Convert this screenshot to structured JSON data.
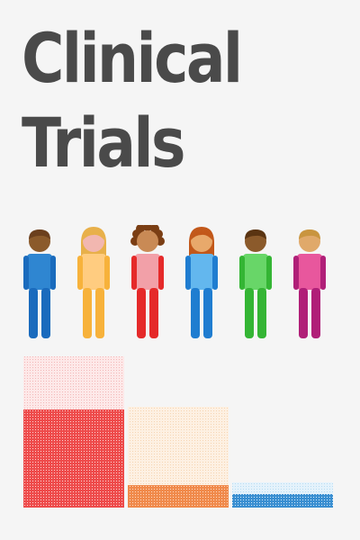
{
  "title": {
    "line1": "Clinical",
    "line2": "Trials",
    "color": "#4a4a4a"
  },
  "background": "#f5f5f5",
  "figures": [
    {
      "skin": "#8b5a2b",
      "hair": "#6b3f1d",
      "hair_style": "short",
      "shirt": "#2f86d1",
      "pants": "#1a6bbd"
    },
    {
      "skin": "#f2b7b0",
      "hair": "#e8b04a",
      "hair_style": "long",
      "shirt": "#ffcc80",
      "pants": "#f7b23b"
    },
    {
      "skin": "#c98a55",
      "hair": "#7a3e14",
      "hair_style": "curly",
      "shirt": "#f2a0a8",
      "pants": "#e52a2a"
    },
    {
      "skin": "#e8a96b",
      "hair": "#c2581a",
      "hair_style": "long",
      "shirt": "#63b7ee",
      "pants": "#1f7dd0"
    },
    {
      "skin": "#8b5a2b",
      "hair": "#5a3412",
      "hair_style": "short",
      "shirt": "#68d668",
      "pants": "#34b534"
    },
    {
      "skin": "#e0a96a",
      "hair": "#c9953f",
      "hair_style": "short",
      "shirt": "#e8579d",
      "pants": "#b01f78"
    }
  ],
  "blocks": [
    {
      "upper_fill": "#fde8e8",
      "upper_dot": "#f3b8b8",
      "upper_level": 0.35,
      "lower_fill": "#ee4b4b",
      "lower_dot": "#fbd0d0",
      "lower_level": 0.65
    },
    {
      "upper_fill": "#fdf0e2",
      "upper_dot": "#f6d5b3",
      "upper_level": 0.78,
      "lower_fill": "#f08a4b",
      "lower_dot": "#fcd7bf",
      "lower_level": 0.22
    },
    {
      "upper_fill": "#e4f2fb",
      "upper_dot": "#b9dcf2",
      "upper_level": 0.45,
      "lower_fill": "#3a8fd1",
      "lower_dot": "#cfe6f7",
      "lower_level": 0.55
    }
  ]
}
